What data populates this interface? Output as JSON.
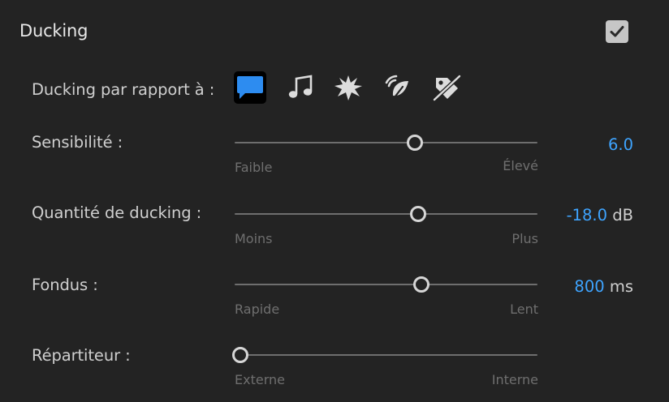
{
  "header": {
    "title": "Ducking",
    "enabled": true
  },
  "duck_against": {
    "label": "Ducking par rapport à :",
    "selected": "dialogue",
    "icons": [
      {
        "name": "dialogue-icon",
        "selected": true
      },
      {
        "name": "music-icon",
        "selected": false
      },
      {
        "name": "sfx-icon",
        "selected": false
      },
      {
        "name": "ambience-icon",
        "selected": false
      },
      {
        "name": "untagged-icon",
        "selected": false
      }
    ],
    "accent_color": "#2d8cf0"
  },
  "sensitivity": {
    "label": "Sensibilité :",
    "min_label": "Faible",
    "max_label": "Élevé",
    "value": "6.0",
    "unit": "",
    "level": 0.6
  },
  "reduce_by": {
    "label": "Quantité de ducking :",
    "min_label": "Moins",
    "max_label": "Plus",
    "value": "-18.0",
    "unit": "dB",
    "level": 0.61
  },
  "fades": {
    "label": "Fondus :",
    "min_label": "Rapide",
    "max_label": "Lent",
    "value": "800",
    "unit": "ms",
    "level": 0.62
  },
  "splitter": {
    "label": "Répartiteur :",
    "min_label": "Externe",
    "max_label": "Interne",
    "level": 0.0
  },
  "colors": {
    "background": "#232323",
    "value_blue": "#3ea4ff",
    "checkbox": "#c6c6c6"
  }
}
